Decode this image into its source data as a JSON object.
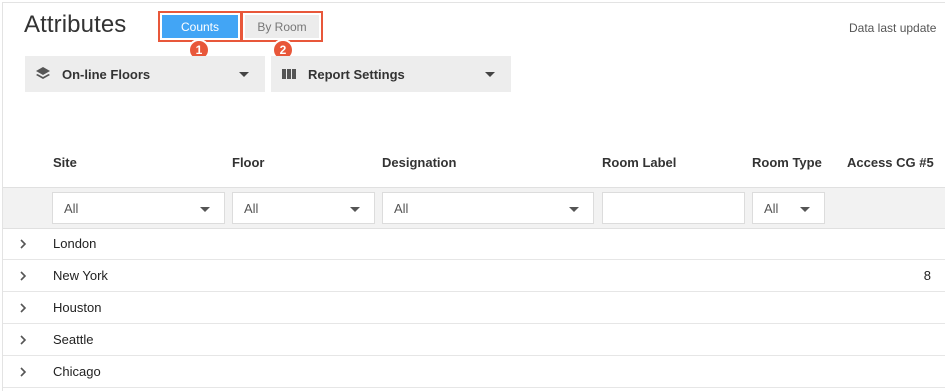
{
  "header": {
    "title": "Attributes",
    "last_update": "Data last update"
  },
  "tabs": [
    {
      "label": "Counts",
      "active": true
    },
    {
      "label": "By Room",
      "active": false
    }
  ],
  "badges": [
    "1",
    "2"
  ],
  "toolbar": {
    "floors_label": "On-line Floors",
    "report_label": "Report Settings"
  },
  "table": {
    "columns": [
      "Site",
      "Floor",
      "Designation",
      "Room Label",
      "Room Type",
      "Access CG #5"
    ],
    "filters": {
      "site": "All",
      "floor": "All",
      "designation": "All",
      "room_label": "",
      "room_type": "All"
    },
    "rows": [
      {
        "site": "London",
        "access": ""
      },
      {
        "site": "New York",
        "access": "8"
      },
      {
        "site": "Houston",
        "access": ""
      },
      {
        "site": "Seattle",
        "access": ""
      },
      {
        "site": "Chicago",
        "access": ""
      }
    ]
  },
  "colors": {
    "accent": "#42a5f5",
    "highlight": "#e8573a"
  }
}
